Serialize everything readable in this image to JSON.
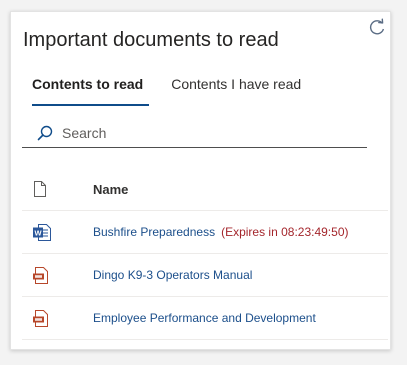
{
  "webpart": {
    "title": "Important documents to read"
  },
  "tabs": [
    {
      "label": "Contents to read",
      "active": true
    },
    {
      "label": "Contents I have read",
      "active": false
    }
  ],
  "search": {
    "placeholder": "Search",
    "value": ""
  },
  "table": {
    "header": {
      "icon": "file-icon",
      "name": "Name"
    },
    "rows": [
      {
        "icon": "word-doc-icon",
        "name": "Bushfire Preparedness",
        "expiry": "(Expires in 08:23:49:50)"
      },
      {
        "icon": "pdf-doc-icon",
        "name": "Dingo K9-3 Operators Manual",
        "expiry": ""
      },
      {
        "icon": "pdf-doc-icon",
        "name": "Employee Performance and Development",
        "expiry": ""
      }
    ]
  },
  "colors": {
    "accent": "#0f4c8a",
    "link": "#1c4f8b",
    "expiry": "#a4262c",
    "word": "#2b579a",
    "pdf": "#b7472a"
  }
}
